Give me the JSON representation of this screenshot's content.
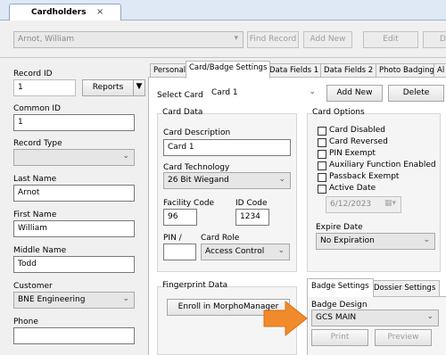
{
  "window_tab": {
    "label": "Cardholders",
    "close": "×"
  },
  "toolbar": {
    "cardholder_select": "Arnot, William",
    "find_record": "Find Record",
    "add_new": "Add New",
    "edit": "Edit",
    "delete_partial": "D"
  },
  "left": {
    "record_id_label": "Record ID",
    "record_id_value": "1",
    "reports_label": "Reports",
    "common_id_label": "Common ID",
    "common_id_value": "1",
    "record_type_label": "Record Type",
    "record_type_value": "",
    "last_name_label": "Last Name",
    "last_name_value": "Arnot",
    "first_name_label": "First Name",
    "first_name_value": "William",
    "middle_name_label": "Middle Name",
    "middle_name_value": "Todd",
    "customer_label": "Customer",
    "customer_value": "BNE Engineering",
    "phone_label": "Phone",
    "phone_value": ""
  },
  "tabs": [
    "Personal",
    "Card/Badge Settings",
    "Data Fields 1",
    "Data Fields 2",
    "Photo Badging",
    "Al"
  ],
  "card": {
    "select_card_label": "Select Card",
    "select_card_value": "Card 1",
    "add_new": "Add New",
    "delete": "Delete"
  },
  "card_data": {
    "title": "Card Data",
    "description_label": "Card Description",
    "description_value": "Card 1",
    "technology_label": "Card Technology",
    "technology_value": "26 Bit Wiegand",
    "facility_label": "Facility Code",
    "facility_value": "96",
    "id_label": "ID Code",
    "id_value": "1234",
    "pin_label": "PIN /",
    "pin_value": "",
    "role_label": "Card Role",
    "role_value": "Access Control"
  },
  "card_options": {
    "title": "Card Options",
    "items": [
      "Card Disabled",
      "Card Reversed",
      "PIN Exempt",
      "Auxiliary Function Enabled",
      "Passback Exempt",
      "Active Date"
    ],
    "active_date_value": "6/12/2023",
    "expire_label": "Expire Date",
    "expire_value": "No Expiration"
  },
  "fingerprint": {
    "title": "Fingerprint Data",
    "enroll": "Enroll in MorphoManager"
  },
  "badge": {
    "tabs": [
      "Badge Settings",
      "Dossier Settings"
    ],
    "design_label": "Badge Design",
    "design_value": "GCS MAIN",
    "print": "Print",
    "preview": "Preview"
  },
  "colors": {
    "arrow": "#f08a2a",
    "tabstrip": "#dfe9f5"
  }
}
